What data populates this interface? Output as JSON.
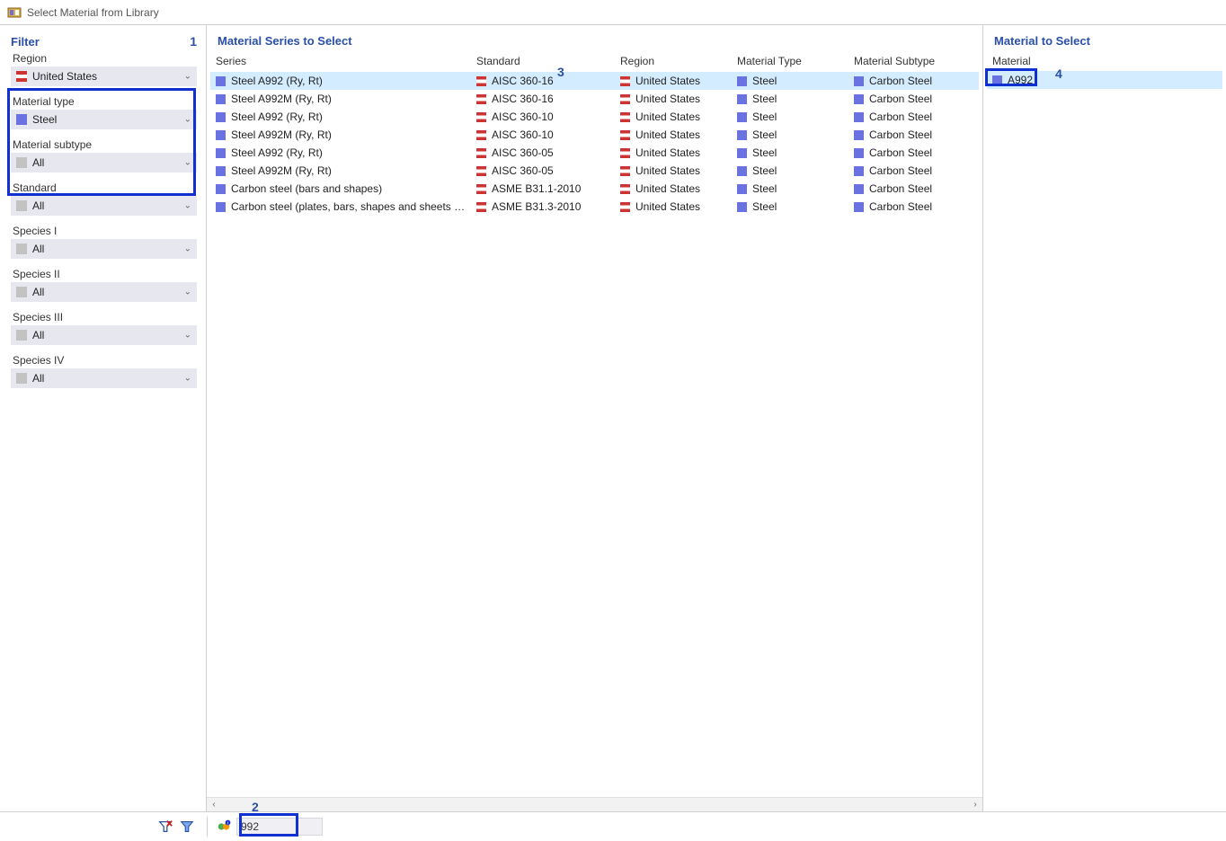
{
  "window": {
    "title": "Select Material from Library"
  },
  "callouts": {
    "c1": "1",
    "c2": "2",
    "c3": "3",
    "c4": "4"
  },
  "filter": {
    "header": "Filter",
    "groups": [
      {
        "label": "Region",
        "value": "United States",
        "icon": "flag"
      },
      {
        "label": "Material type",
        "value": "Steel",
        "icon": "steel"
      },
      {
        "label": "Material subtype",
        "value": "All",
        "icon": "gray"
      },
      {
        "label": "Standard",
        "value": "All",
        "icon": "gray"
      },
      {
        "label": "Species I",
        "value": "All",
        "icon": "gray"
      },
      {
        "label": "Species II",
        "value": "All",
        "icon": "gray"
      },
      {
        "label": "Species III",
        "value": "All",
        "icon": "gray"
      },
      {
        "label": "Species IV",
        "value": "All",
        "icon": "gray"
      }
    ]
  },
  "series": {
    "header": "Material Series to Select",
    "columns": [
      "Series",
      "Standard",
      "Region",
      "Material Type",
      "Material Subtype"
    ],
    "rows": [
      {
        "series": "Steel A992 (Ry, Rt)",
        "standard": "AISC 360-16",
        "region": "United States",
        "type": "Steel",
        "subtype": "Carbon Steel",
        "selected": true
      },
      {
        "series": "Steel A992M (Ry, Rt)",
        "standard": "AISC 360-16",
        "region": "United States",
        "type": "Steel",
        "subtype": "Carbon Steel"
      },
      {
        "series": "Steel A992 (Ry, Rt)",
        "standard": "AISC 360-10",
        "region": "United States",
        "type": "Steel",
        "subtype": "Carbon Steel"
      },
      {
        "series": "Steel A992M (Ry, Rt)",
        "standard": "AISC 360-10",
        "region": "United States",
        "type": "Steel",
        "subtype": "Carbon Steel"
      },
      {
        "series": "Steel A992 (Ry, Rt)",
        "standard": "AISC 360-05",
        "region": "United States",
        "type": "Steel",
        "subtype": "Carbon Steel"
      },
      {
        "series": "Steel A992M (Ry, Rt)",
        "standard": "AISC 360-05",
        "region": "United States",
        "type": "Steel",
        "subtype": "Carbon Steel"
      },
      {
        "series": "Carbon steel (bars and shapes)",
        "standard": "ASME B31.1-2010",
        "region": "United States",
        "type": "Steel",
        "subtype": "Carbon Steel"
      },
      {
        "series": "Carbon steel (plates, bars, shapes and sheets - str...",
        "standard": "ASME B31.3-2010",
        "region": "United States",
        "type": "Steel",
        "subtype": "Carbon Steel"
      }
    ]
  },
  "material": {
    "header": "Material to Select",
    "column": "Material",
    "rows": [
      {
        "name": "A992",
        "selected": true
      }
    ]
  },
  "status": {
    "search_value": "992"
  }
}
